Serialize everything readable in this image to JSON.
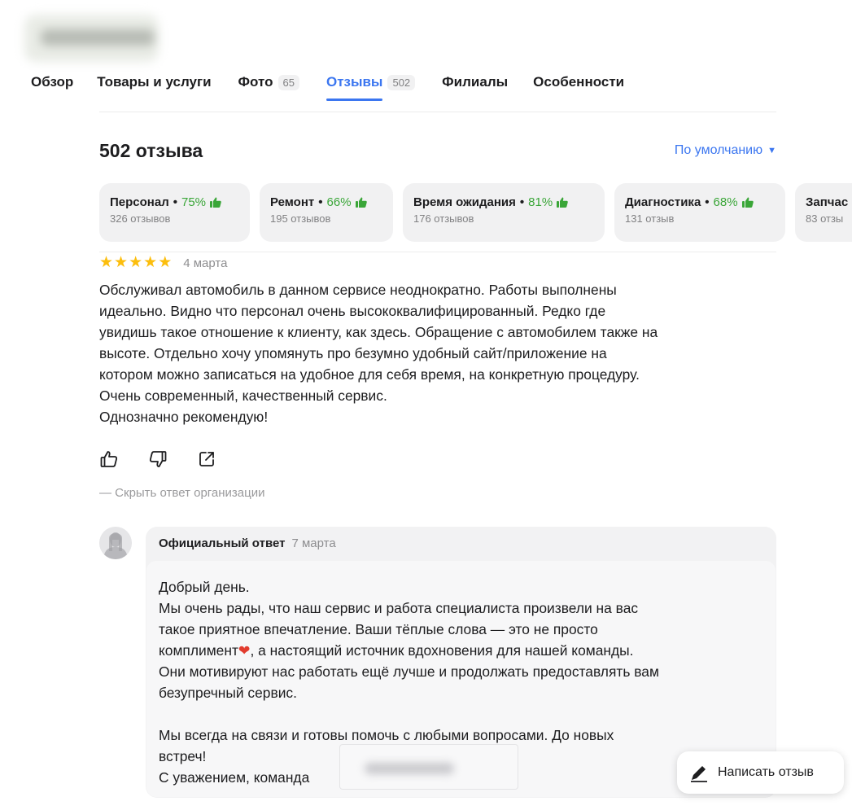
{
  "tabs": [
    {
      "label": "Обзор",
      "count": ""
    },
    {
      "label": "Товары и услуги",
      "count": ""
    },
    {
      "label": "Фото",
      "count": "65"
    },
    {
      "label": "Отзывы",
      "count": "502"
    },
    {
      "label": "Филиалы",
      "count": ""
    },
    {
      "label": "Особенности",
      "count": ""
    }
  ],
  "reviews_heading": "502 отзыва",
  "sort_label": "По умолчанию",
  "aspects": [
    {
      "name": "Персонал",
      "percent": "75%",
      "sub": "326 отзывов"
    },
    {
      "name": "Ремонт",
      "percent": "66%",
      "sub": "195 отзывов"
    },
    {
      "name": "Время ожидания",
      "percent": "81%",
      "sub": "176 отзывов"
    },
    {
      "name": "Диагностика",
      "percent": "68%",
      "sub": "131 отзыв"
    },
    {
      "name": "Запчас",
      "percent": "",
      "sub": "83 отзы"
    }
  ],
  "review": {
    "rating": 5,
    "date": "4 марта",
    "text": "Обслуживал автомобиль в данном сервисе неоднократно. Работы выполнены\nидеально. Видно что персонал очень высококвалифицированный. Редко где\nувидишь такое отношение к клиенту, как здесь. Обращение с автомобилем также на\nвысоте. Отдельно хочу упомянуть про безумно удобный сайт/приложение на\nкотором можно записаться на удобное для себя время, на конкретную процедуру.\nОчень современный, качественный сервис.\nОднозначно рекомендую!"
  },
  "hide_answer_label": "— Скрыть ответ организации",
  "answer": {
    "label": "Официальный ответ",
    "date": "7 марта",
    "text_part1": "Добрый день.\nМы очень рады, что наш сервис и работа специалиста произвели на вас\nтакое приятное впечатление. Ваши тёплые слова — это не просто\nкомплимент",
    "emoji": "❤",
    "text_part2": ", а настоящий источник вдохновения для нашей команды.\nОни мотивируют нас работать ещё лучше и продолжать предоставлять вам\nбезупречный сервис.\n\nМы всегда на связи и готовы помочь с любыми вопросами. До новых\nвстреч!\nС уважением, команда"
  },
  "write_review_label": "Написать отзыв",
  "colors": {
    "accent": "#3b76f0",
    "positive": "#3aa638",
    "star": "#fcbe0d"
  }
}
